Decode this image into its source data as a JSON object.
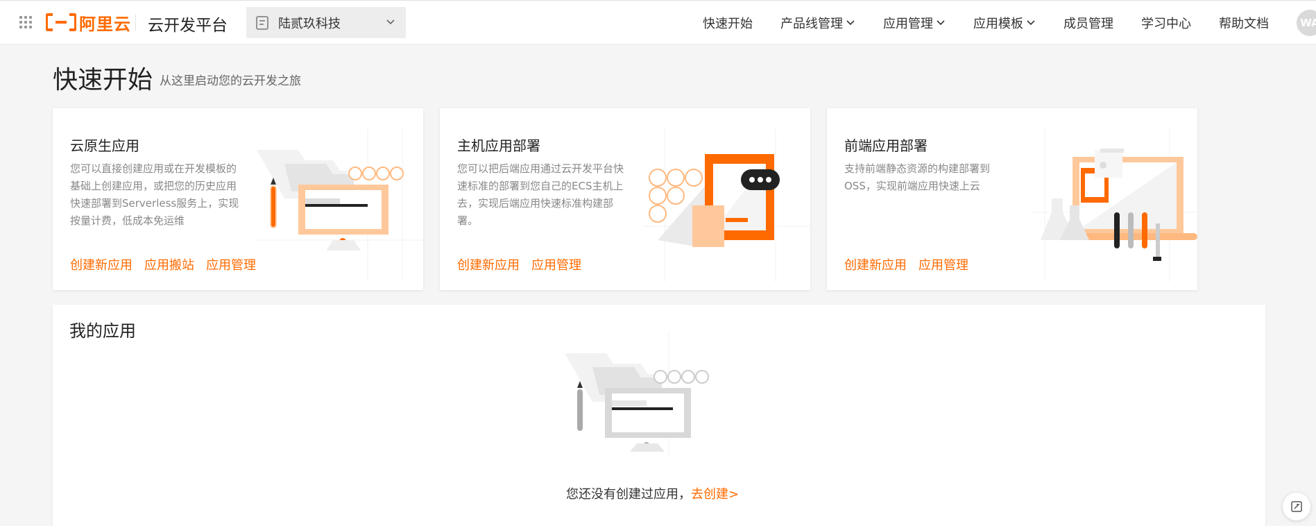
{
  "brand": {
    "name": "阿里云",
    "accent": "#ff6a00"
  },
  "header": {
    "app_title": "云开发平台",
    "org_select": {
      "value": "陆贰玖科技"
    },
    "nav": [
      {
        "label": "快速开始",
        "dropdown": false
      },
      {
        "label": "产品线管理",
        "dropdown": true
      },
      {
        "label": "应用管理",
        "dropdown": true
      },
      {
        "label": "应用模板",
        "dropdown": true
      },
      {
        "label": "成员管理",
        "dropdown": false
      },
      {
        "label": "学习中心",
        "dropdown": false
      },
      {
        "label": "帮助文档",
        "dropdown": false
      }
    ],
    "avatar": "WA"
  },
  "page": {
    "title": "快速开始",
    "subtitle": "从这里启动您的云开发之旅"
  },
  "cards": [
    {
      "title": "云原生应用",
      "desc": "您可以直接创建应用或在开发模板的基础上创建应用，或把您的历史应用快速部署到Serverless服务上，实现按量计费，低成本免运维",
      "links": [
        "创建新应用",
        "应用搬站",
        "应用管理"
      ]
    },
    {
      "title": "主机应用部署",
      "desc": "您可以把后端应用通过云开发平台快速标准的部署到您自己的ECS主机上去，实现后端应用快速标准构建部署。",
      "links": [
        "创建新应用",
        "应用管理"
      ]
    },
    {
      "title": "前端应用部署",
      "desc": "支持前端静态资源的构建部署到OSS，实现前端应用快速上云",
      "links": [
        "创建新应用",
        "应用管理"
      ]
    }
  ],
  "my_apps": {
    "title": "我的应用",
    "empty_text": "您还没有创建过应用，",
    "empty_link": "去创建>"
  },
  "icons": {
    "apps_grid": "apps-grid-icon",
    "org": "organization-icon",
    "chevron": "chevron-down-icon",
    "feedback": "feedback-icon"
  }
}
